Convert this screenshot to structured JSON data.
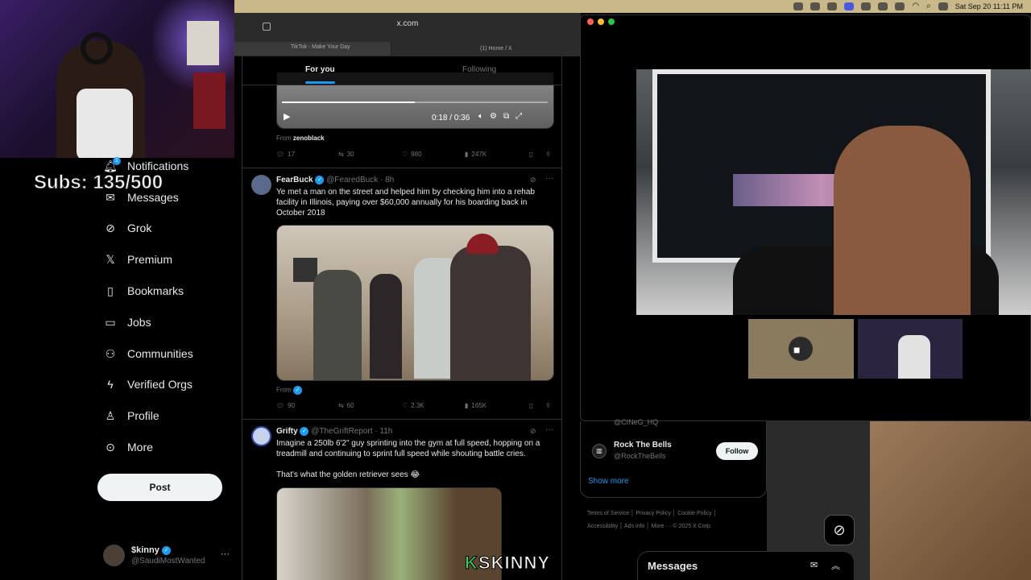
{
  "menubar": {
    "datetime": "Sat Sep 20  11:11 PM"
  },
  "browser": {
    "url": "x.com",
    "tabs": [
      "TikTok - Make Your Day",
      "(1) Home / X"
    ]
  },
  "overlay": {
    "subs": "Subs: 135/500",
    "brand_k": "K",
    "brand_rest": "SKINNY"
  },
  "sidebar": {
    "notification_count": "1",
    "items": [
      {
        "label": "Notifications",
        "icon": "bell-icon"
      },
      {
        "label": "Messages",
        "icon": "envelope-icon"
      },
      {
        "label": "Grok",
        "icon": "grok-icon"
      },
      {
        "label": "Premium",
        "icon": "x-logo-icon"
      },
      {
        "label": "Bookmarks",
        "icon": "bookmark-icon"
      },
      {
        "label": "Jobs",
        "icon": "briefcase-icon"
      },
      {
        "label": "Communities",
        "icon": "people-icon"
      },
      {
        "label": "Verified Orgs",
        "icon": "lightning-icon"
      },
      {
        "label": "Profile",
        "icon": "person-icon"
      },
      {
        "label": "More",
        "icon": "more-circle-icon"
      }
    ],
    "post_label": "Post",
    "account": {
      "name": "$kinny",
      "handle": "@SaudiMostWanted"
    }
  },
  "feed": {
    "tabs": [
      "For you",
      "Following"
    ],
    "video_time": "0:18 / 0:36",
    "tweet0": {
      "from_label": "From",
      "from_user": "zenoblack",
      "replies": "17",
      "reposts": "30",
      "likes": "980",
      "views": "247K"
    },
    "tweet1": {
      "name": "FearBuck",
      "handle": "@FearedBuck",
      "time": "· 8h",
      "text": "Ye met a man on the street and helped him by checking him into a rehab facility in Illinois, paying over $60,000 annually for his boarding back in October 2018",
      "from_label": "From",
      "replies": "90",
      "reposts": "60",
      "likes": "2.3K",
      "views": "165K"
    },
    "tweet2": {
      "name": "Grifty",
      "handle": "@TheGriftReport",
      "time": "· 11h",
      "text1": "Imagine a 250lb 6'2\" guy sprinting into the gym at full speed, hopping on a treadmill and continuing to sprint full speed while shouting battle cries.",
      "text2": "That's what the golden retriever sees 😂"
    }
  },
  "who_to_follow": {
    "cut_handle": "@CINeG_HQ",
    "name": "Rock The Bells",
    "handle": "@RockTheBells",
    "follow_label": "Follow",
    "show_more": "Show more"
  },
  "footer": {
    "links": [
      "Terms of Service",
      "Privacy Policy",
      "Cookie Policy",
      "Accessibility",
      "Ads info",
      "More ···",
      "© 2025 X Corp."
    ]
  },
  "messages_drawer": {
    "title": "Messages"
  }
}
